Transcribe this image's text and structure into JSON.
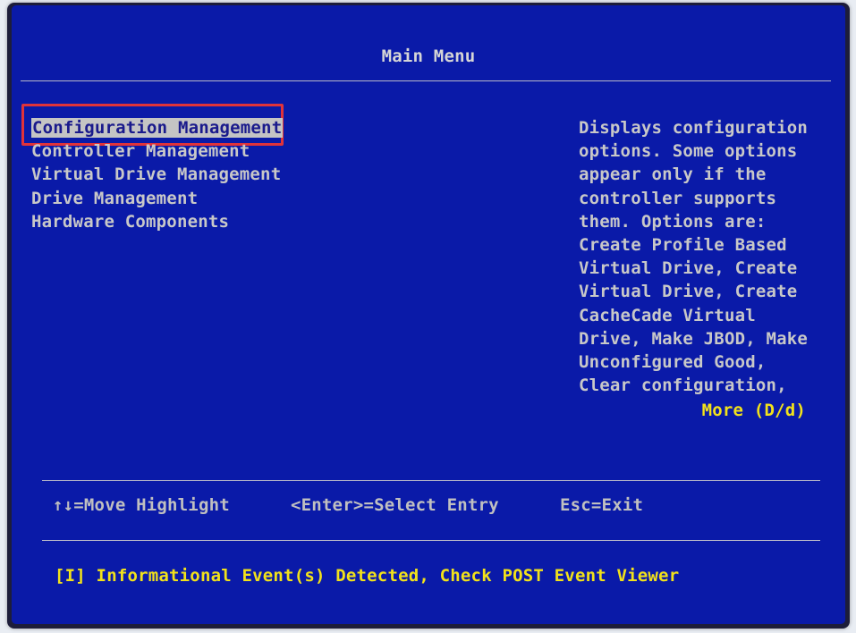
{
  "title": "Main Menu",
  "menu": {
    "items": [
      {
        "label": "Configuration Management",
        "selected": true
      },
      {
        "label": "Controller Management"
      },
      {
        "label": "Virtual Drive Management"
      },
      {
        "label": "Drive Management"
      },
      {
        "label": "Hardware Components"
      }
    ]
  },
  "help": {
    "lines": [
      "Displays configuration",
      "options. Some options",
      "appear only if the",
      "controller supports",
      "them. Options are:",
      "Create Profile Based",
      "Virtual Drive, Create",
      "Virtual Drive, Create",
      "CacheCade Virtual",
      "Drive, Make JBOD, Make",
      "Unconfigured Good,",
      "Clear configuration,"
    ],
    "more": "More (D/d)"
  },
  "hints": {
    "move": "↑↓=Move Highlight",
    "select": "<Enter>=Select Entry",
    "exit": "Esc=Exit"
  },
  "status": "[I] Informational Event(s) Detected, Check POST Event Viewer",
  "colors": {
    "background": "#0a1aa8",
    "text": "#c8c8c8",
    "highlight": "#f2e21a",
    "focus_outline": "#e0333a"
  }
}
